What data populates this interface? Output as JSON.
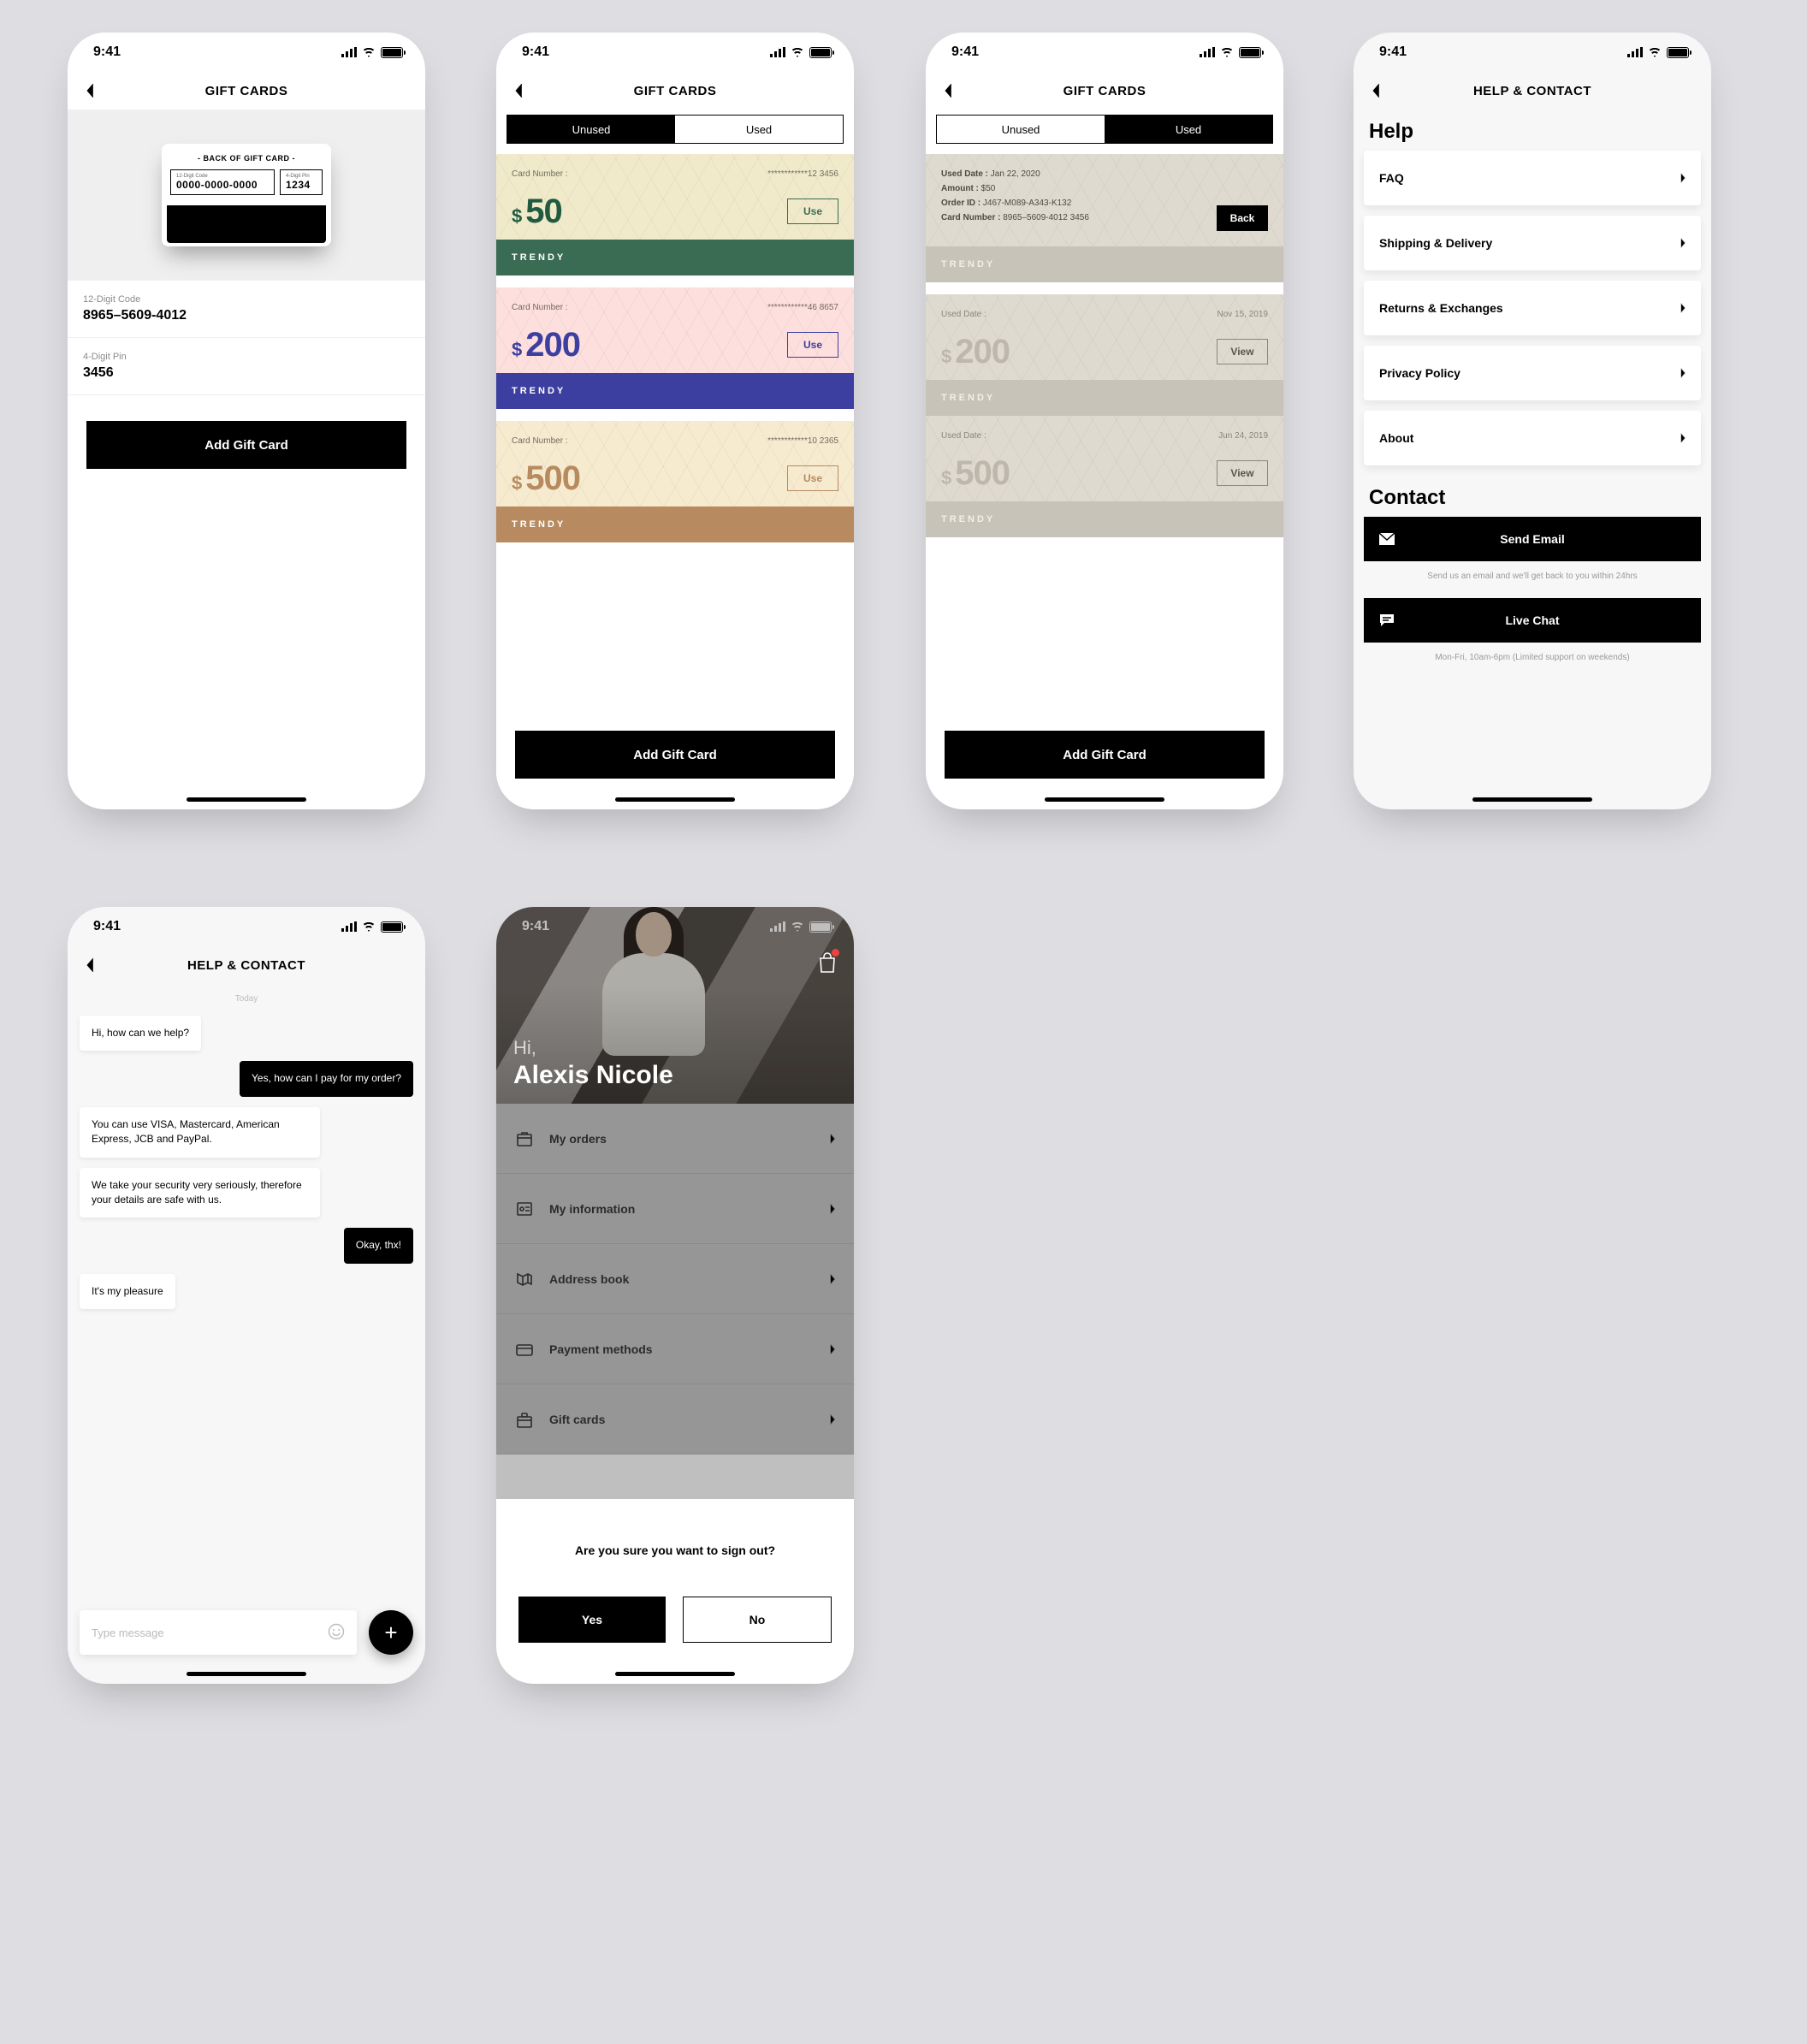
{
  "status_time": "9:41",
  "screen1": {
    "title": "GIFT CARDS",
    "back_of_card": "- BACK OF GIFT CARD -",
    "code_box_label": "12-Digit Code",
    "code_box_value": "0000-0000-0000",
    "pin_box_label": "4-Digit Pin",
    "pin_box_value": "1234",
    "field_code_label": "12-Digit Code",
    "field_code_value": "8965–5609-4012",
    "field_pin_label": "4-Digit Pin",
    "field_pin_value": "3456",
    "add_button": "Add Gift Card"
  },
  "screen2": {
    "title": "GIFT CARDS",
    "tab_unused": "Unused",
    "tab_used": "Used",
    "cards": [
      {
        "num_label": "Card Number :",
        "num": "************12 3456",
        "amount": "50",
        "action": "Use",
        "brand": "TRENDY"
      },
      {
        "num_label": "Card Number :",
        "num": "************46 8657",
        "amount": "200",
        "action": "Use",
        "brand": "TRENDY"
      },
      {
        "num_label": "Card Number :",
        "num": "************10 2365",
        "amount": "500",
        "action": "Use",
        "brand": "TRENDY"
      }
    ],
    "add_button": "Add Gift Card"
  },
  "screen3": {
    "title": "GIFT CARDS",
    "tab_unused": "Unused",
    "tab_used": "Used",
    "detail": {
      "used_date_label": "Used Date :",
      "used_date": "Jan 22, 2020",
      "amount_label": "Amount :",
      "amount": "$50",
      "order_label": "Order ID :",
      "order": "J467-M089-A343-K132",
      "card_label": "Card Number :",
      "card": "8965–5609-4012 3456",
      "back": "Back",
      "brand": "TRENDY"
    },
    "cards": [
      {
        "left_label": "Used Date :",
        "right": "Nov 15, 2019",
        "amount": "200",
        "action": "View",
        "brand": "TRENDY"
      },
      {
        "left_label": "Used Date :",
        "right": "Jun 24, 2019",
        "amount": "500",
        "action": "View",
        "brand": "TRENDY"
      }
    ],
    "add_button": "Add Gift Card"
  },
  "screen4": {
    "title": "HELP & CONTACT",
    "help_h": "Help",
    "items": [
      "FAQ",
      "Shipping & Delivery",
      "Returns & Exchanges",
      "Privacy Policy",
      "About"
    ],
    "contact_h": "Contact",
    "email_btn": "Send Email",
    "email_cap": "Send us an email and we'll get back to you within 24hrs",
    "chat_btn": "Live Chat",
    "chat_cap": "Mon-Fri, 10am-6pm (Limited support on weekends)"
  },
  "screen5": {
    "title": "HELP & CONTACT",
    "date": "Today",
    "msgs": [
      {
        "side": "l",
        "text": "Hi, how can we help?"
      },
      {
        "side": "r",
        "text": "Yes, how can I pay for my order?"
      },
      {
        "side": "l",
        "text": "You can use VISA, Mastercard, American Express, JCB and PayPal."
      },
      {
        "side": "l",
        "text": "We take your security very seriously, therefore your details are safe with us."
      },
      {
        "side": "r",
        "text": "Okay, thx!"
      },
      {
        "side": "l",
        "text": "It's my pleasure"
      }
    ],
    "placeholder": "Type message"
  },
  "screen6": {
    "hi": "Hi,",
    "name": "Alexis Nicole",
    "menu": [
      "My orders",
      "My information",
      "Address book",
      "Payment methods",
      "Gift cards"
    ],
    "sheet_q": "Are you sure you want to sign out?",
    "yes": "Yes",
    "no": "No"
  }
}
